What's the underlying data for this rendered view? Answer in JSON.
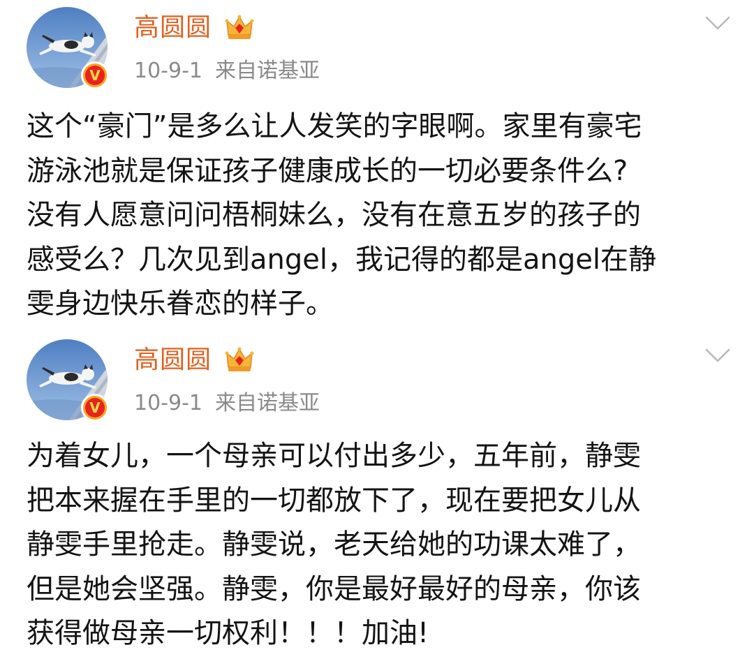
{
  "posts": [
    {
      "username": "高圆圆",
      "date": "10-9-1",
      "source": "来自诺基亚",
      "verified_badge": "V",
      "lines": [
        "这个“豪门”是多么让人发笑的字眼啊。家里有豪宅",
        "游泳池就是保证孩子健康成长的一切必要条件么?",
        "没有人愿意问问梧桐妹么，没有在意五岁的孩子的",
        "感受么？几次见到angel，我记得的都是angel在静",
        "雯身边快乐眷恋的样子。"
      ]
    },
    {
      "username": "高圆圆",
      "date": "10-9-1",
      "source": "来自诺基亚",
      "verified_badge": "V",
      "lines": [
        "为着女儿，一个母亲可以付出多少，五年前，静雯",
        "把本来握在手里的一切都放下了，现在要把女儿从",
        "静雯手里抢走。静雯说，老天给她的功课太难了，",
        "但是她会坚强。静雯，你是最好最好的母亲，你该",
        "获得做母亲一切权利！！！加油!"
      ]
    }
  ],
  "colors": {
    "username": "#e0621f",
    "meta": "#8a8a8a",
    "body": "#141414",
    "badge_outer": "#f5a623",
    "badge_inner": "#e8231b"
  },
  "icons": {
    "avatar": "cat-jumping-avatar",
    "crown": "crown-membership-icon",
    "chevron": "chevron-down-icon",
    "badge": "verified-v-badge-icon"
  }
}
